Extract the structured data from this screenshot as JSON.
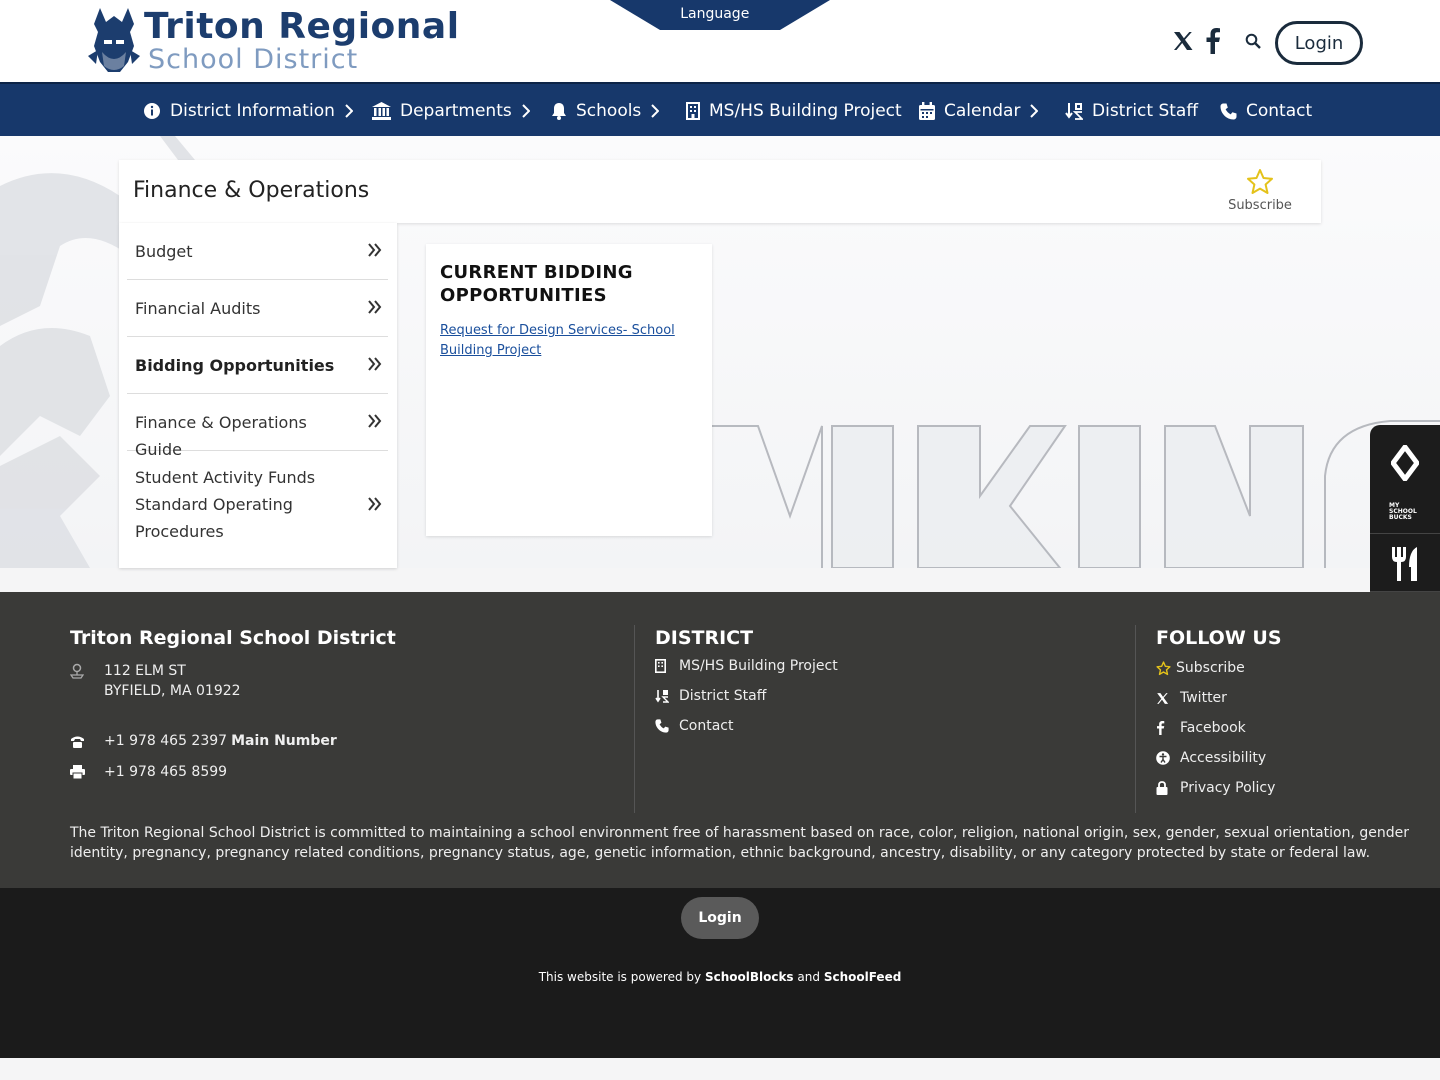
{
  "header": {
    "title": "Triton Regional",
    "subtitle": "School District",
    "language_label": "Language",
    "login_label": "Login",
    "icons": [
      "x-twitter-icon",
      "facebook-icon",
      "search-icon"
    ]
  },
  "nav": {
    "items": [
      {
        "label": "District Information",
        "icon": "info-icon",
        "chevron": true
      },
      {
        "label": "Departments",
        "icon": "building-columns-icon",
        "chevron": true
      },
      {
        "label": "Schools",
        "icon": "bell-icon",
        "chevron": true
      },
      {
        "label": "MS/HS Building Project",
        "icon": "building-icon",
        "chevron": false
      },
      {
        "label": "Calendar",
        "icon": "calendar-icon",
        "chevron": true
      },
      {
        "label": "District Staff",
        "icon": "sort-icon",
        "chevron": false
      },
      {
        "label": "Contact",
        "icon": "phone-icon",
        "chevron": false
      }
    ]
  },
  "page": {
    "title": "Finance & Operations",
    "subscribe_label": "Subscribe"
  },
  "sidebar": {
    "items": [
      {
        "label": "Budget",
        "active": false
      },
      {
        "label": "Financial Audits",
        "active": false
      },
      {
        "label": "Bidding Opportunities",
        "active": true
      },
      {
        "label": "Finance & Operations Guide",
        "active": false
      },
      {
        "label": "Student Activity Funds Standard Operating Procedures",
        "active": false
      }
    ]
  },
  "content": {
    "heading": "CURRENT BIDDING OPPORTUNITIES",
    "link": "Request for Design Services- School Building Project"
  },
  "widget": {
    "items": [
      "revtrak-icon",
      "myschoolbucks-icon",
      "utensils-icon",
      "info-circle-icon"
    ],
    "myschoolbucks_text": "MY SCHOOL BUCKS"
  },
  "footer": {
    "district_name": "Triton Regional School District",
    "address_line1": "112 ELM ST",
    "address_line2": "BYFIELD, MA 01922",
    "phone": "+1 978 465 2397",
    "phone_label": "Main Number",
    "fax": "+1 978 465 8599",
    "district_heading": "DISTRICT",
    "district_links": [
      "MS/HS Building Project",
      "District Staff",
      "Contact"
    ],
    "follow_heading": "FOLLOW US",
    "follow_links": [
      "Subscribe",
      "Twitter",
      "Facebook",
      "Accessibility",
      "Privacy Policy"
    ],
    "notice": "The Triton Regional School District is committed to maintaining a school environment free of harassment based on race, color, religion, national origin, sex, gender, sexual orientation, gender identity, pregnancy, pregnancy related conditions, pregnancy status, age, genetic information, ethnic background, ancestry, disability, or any category protected by state or federal law."
  },
  "bottom": {
    "login_label": "Login",
    "powered_prefix": "This website is powered by",
    "powered_brand1": "SchoolBlocks",
    "powered_and": "and",
    "powered_brand2": "SchoolFeed"
  },
  "colors": {
    "nav": "#17386b",
    "brand": "#1c3d6e",
    "footer": "#3a3a38",
    "bottom": "#1b1b1b",
    "star": "#e4c21a"
  }
}
